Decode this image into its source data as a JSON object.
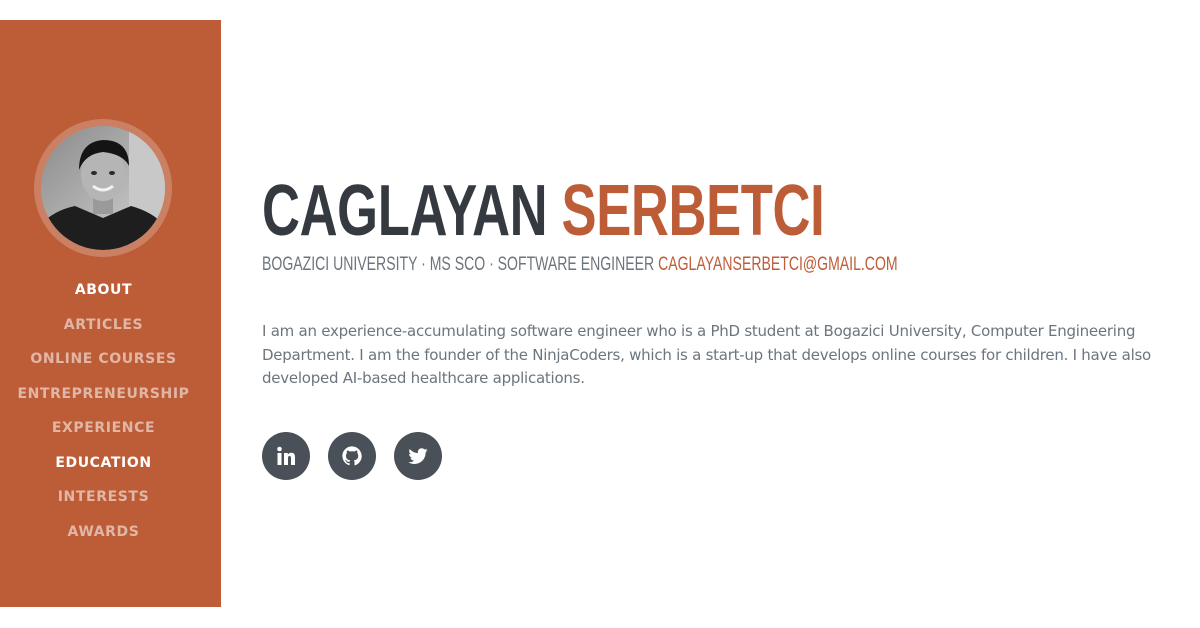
{
  "profile": {
    "first_name": "CAGLAYAN",
    "last_name": "SERBETCI",
    "subheading": "BOGAZICI UNIVERSITY · MS SCO · SOFTWARE ENGINEER",
    "email": "CAGLAYANSERBETCI@GMAIL.COM",
    "bio": "I am an experience-accumulating software engineer who is a PhD student at Bogazici University, Computer Engineering Department. I am the founder of the NinjaCoders, which is a start-up that develops online courses for children. I have also developed AI-based healthcare applications."
  },
  "nav": {
    "items": [
      {
        "label": "ABOUT",
        "active": true
      },
      {
        "label": "ARTICLES",
        "active": false
      },
      {
        "label": "ONLINE COURSES",
        "active": false
      },
      {
        "label": "ENTREPRENEURSHIP",
        "active": false
      },
      {
        "label": "EXPERIENCE",
        "active": false
      },
      {
        "label": "EDUCATION",
        "active": true
      },
      {
        "label": "INTERESTS",
        "active": false
      },
      {
        "label": "AWARDS",
        "active": false
      }
    ]
  },
  "socials": [
    {
      "icon": "linkedin-icon"
    },
    {
      "icon": "github-icon"
    },
    {
      "icon": "twitter-icon"
    }
  ],
  "colors": {
    "sidebar": "#bd5d38",
    "accent": "#bd5d38",
    "heading": "#343a40",
    "muted": "#6c757d",
    "social_bg": "#495057"
  }
}
